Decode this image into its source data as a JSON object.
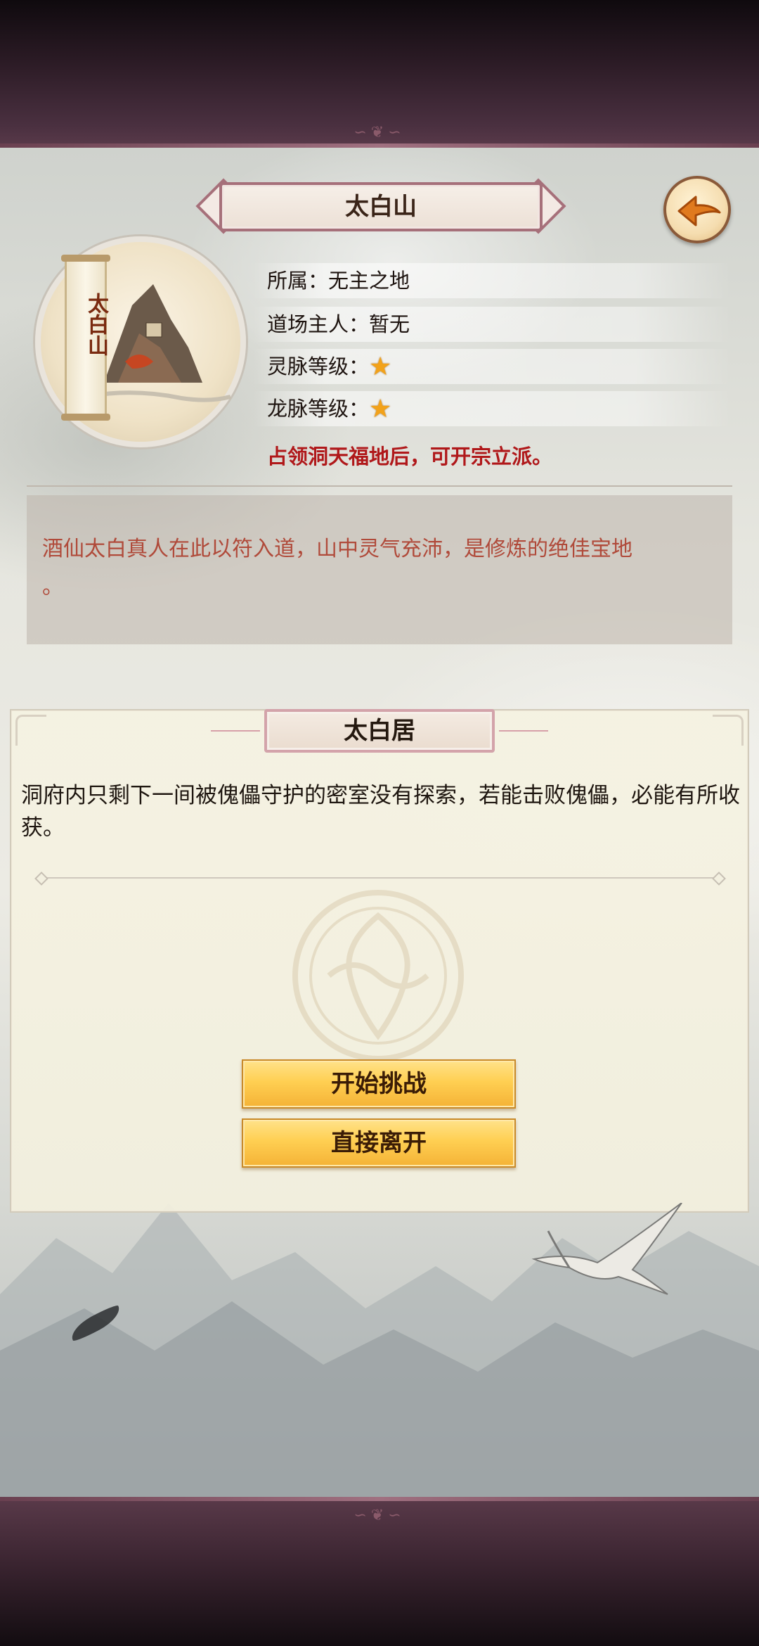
{
  "header": {
    "title": "太白山"
  },
  "location": {
    "scroll_name": "太白山",
    "info": {
      "affiliation": "所属：无主之地",
      "owner": "道场主人：暂无",
      "spirit_vein_label": "灵脉等级：",
      "spirit_vein_stars": 1,
      "dragon_vein_label": "龙脉等级：",
      "dragon_vein_stars": 1
    },
    "note": "占领洞天福地后，可开宗立派。",
    "description_line1": "酒仙太白真人在此以符入道，山中灵气充沛，是修炼的绝佳宝地",
    "description_line2": "。"
  },
  "panel": {
    "title": "太白居",
    "body": "洞府内只剩下一间被傀儡守护的密室没有探索，若能击败傀儡，必能有所收获。",
    "buttons": {
      "challenge": "开始挑战",
      "leave": "直接离开"
    }
  },
  "icons": {
    "back": "back-arrow-icon",
    "star": "star-icon"
  },
  "colors": {
    "note_red": "#b0181a",
    "description": "#b04a3a",
    "gold_button": "#ffcf52"
  }
}
